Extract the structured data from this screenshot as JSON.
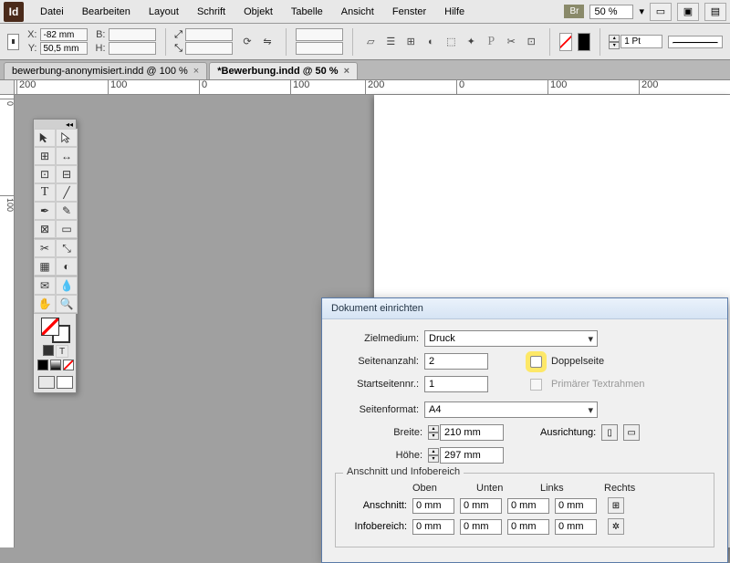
{
  "app": {
    "badge": "Id",
    "br": "Br"
  },
  "menu": {
    "items": [
      "Datei",
      "Bearbeiten",
      "Layout",
      "Schrift",
      "Objekt",
      "Tabelle",
      "Ansicht",
      "Fenster",
      "Hilfe"
    ],
    "zoom": "50 %"
  },
  "control": {
    "x_label": "X:",
    "x": "-82 mm",
    "y_label": "Y:",
    "y": "50,5 mm",
    "w_label": "B:",
    "w": "",
    "h_label": "H:",
    "h": "",
    "stroke_label": "1 Pt"
  },
  "tabs": [
    {
      "label": "bewerbung-anonymisiert.indd @ 100 %",
      "active": false
    },
    {
      "label": "*Bewerbung.indd @ 50 %",
      "active": true
    }
  ],
  "ruler": {
    "ticks": [
      "200",
      "100",
      "0",
      "100",
      "200",
      "0",
      "100",
      "200"
    ]
  },
  "ruler_v": {
    "ticks": [
      "0",
      "100"
    ]
  },
  "dialog": {
    "title": "Dokument einrichten",
    "zielmedium_label": "Zielmedium:",
    "zielmedium": "Druck",
    "seitenanzahl_label": "Seitenanzahl:",
    "seitenanzahl": "2",
    "startseite_label": "Startseitennr.:",
    "startseite": "1",
    "doppelseite": "Doppelseite",
    "primaer": "Primärer Textrahmen",
    "seitenformat_label": "Seitenformat:",
    "seitenformat": "A4",
    "breite_label": "Breite:",
    "breite": "210 mm",
    "hoehe_label": "Höhe:",
    "hoehe": "297 mm",
    "ausrichtung_label": "Ausrichtung:",
    "fieldset_title": "Anschnitt und Infobereich",
    "cols": [
      "Oben",
      "Unten",
      "Links",
      "Rechts"
    ],
    "anschnitt_label": "Anschnitt:",
    "anschnitt": [
      "0 mm",
      "0 mm",
      "0 mm",
      "0 mm"
    ],
    "infobereich_label": "Infobereich:",
    "infobereich": [
      "0 mm",
      "0 mm",
      "0 mm",
      "0 mm"
    ]
  }
}
